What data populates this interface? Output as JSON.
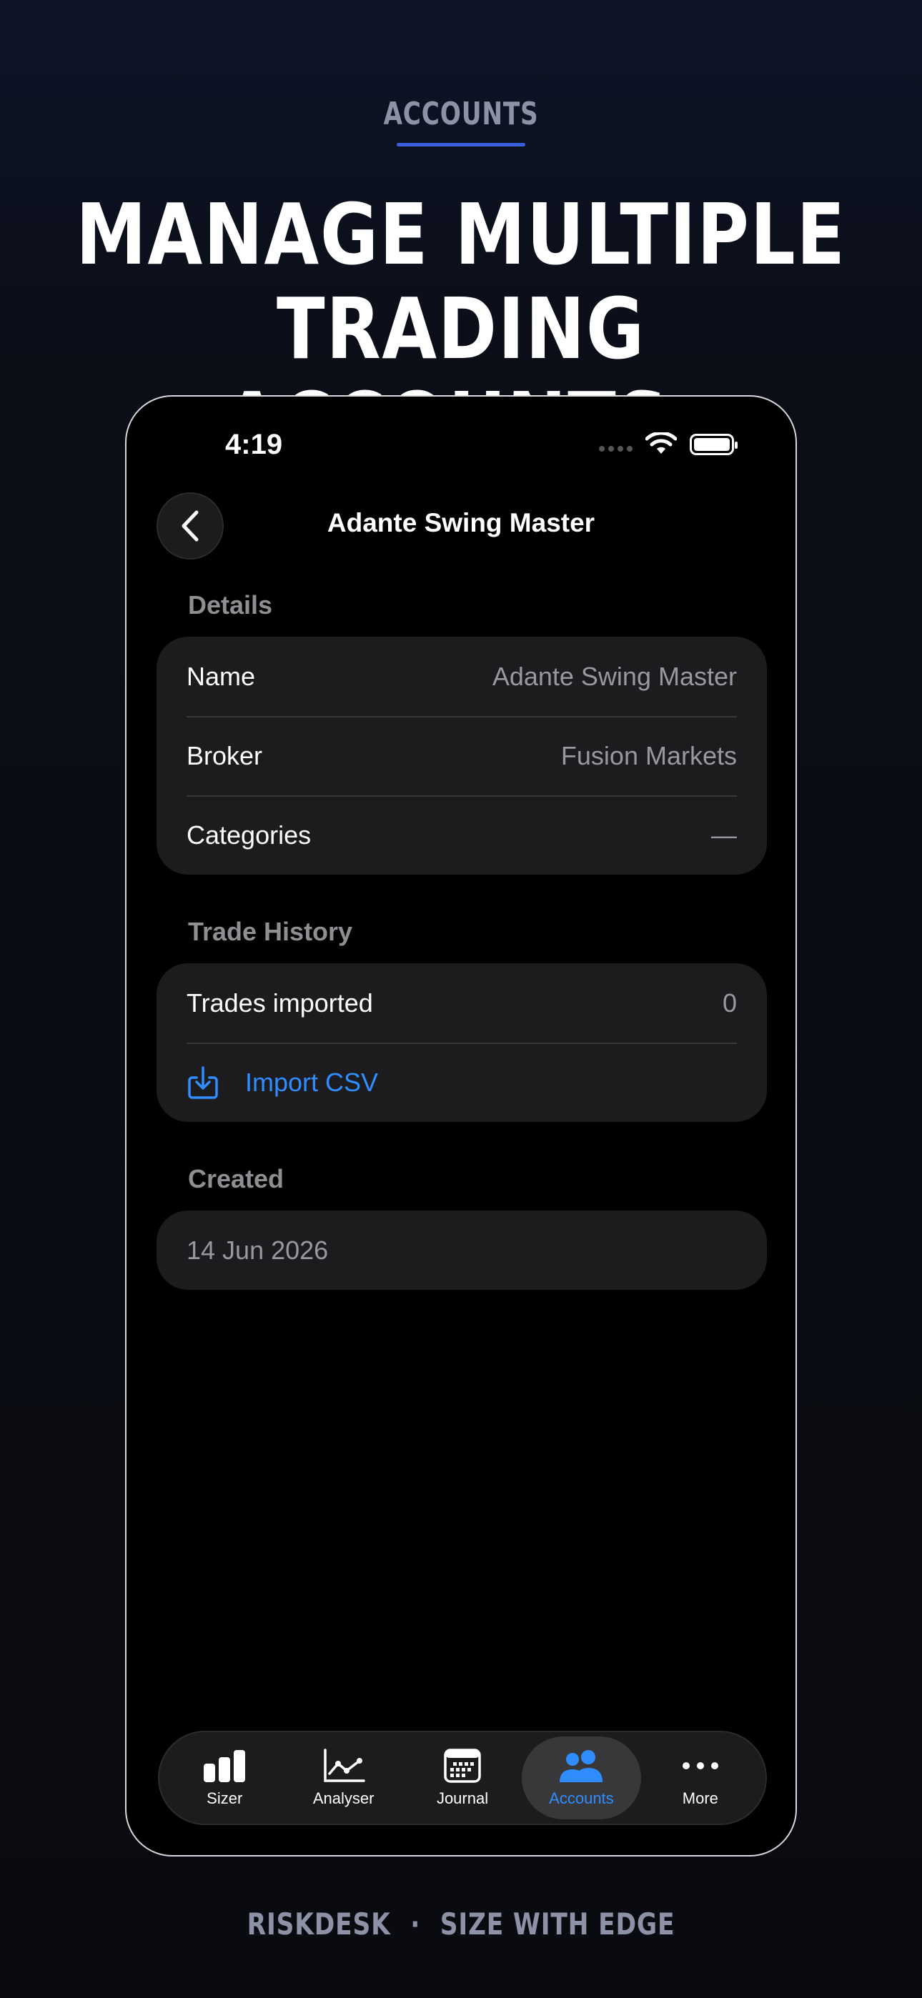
{
  "hero": {
    "eyebrow": "ACCOUNTS",
    "headline_line1": "MANAGE MULTIPLE",
    "headline_line2": "TRADING ACCOUNTS."
  },
  "status_bar": {
    "time": "4:19"
  },
  "nav": {
    "title": "Adante Swing Master"
  },
  "details": {
    "section_label": "Details",
    "rows": [
      {
        "label": "Name",
        "value": "Adante Swing Master"
      },
      {
        "label": "Broker",
        "value": "Fusion Markets"
      },
      {
        "label": "Categories",
        "value": "—"
      }
    ]
  },
  "trade_history": {
    "section_label": "Trade History",
    "trades_imported_label": "Trades imported",
    "trades_imported_value": "0",
    "import_label": "Import CSV"
  },
  "created": {
    "section_label": "Created",
    "date": "14 Jun 2026"
  },
  "tabbar": {
    "tabs": [
      {
        "label": "Sizer",
        "icon": "bar-chart-icon"
      },
      {
        "label": "Analyser",
        "icon": "line-chart-icon"
      },
      {
        "label": "Journal",
        "icon": "calendar-icon"
      },
      {
        "label": "Accounts",
        "icon": "people-icon",
        "active": true
      },
      {
        "label": "More",
        "icon": "ellipsis-icon"
      }
    ]
  },
  "colors": {
    "accent": "#2f8dff",
    "underline": "#3a5fe0",
    "card": "#1c1c1e"
  },
  "footer": {
    "brand": "RISKDESK",
    "separator": "·",
    "tagline": "SIZE WITH EDGE"
  }
}
